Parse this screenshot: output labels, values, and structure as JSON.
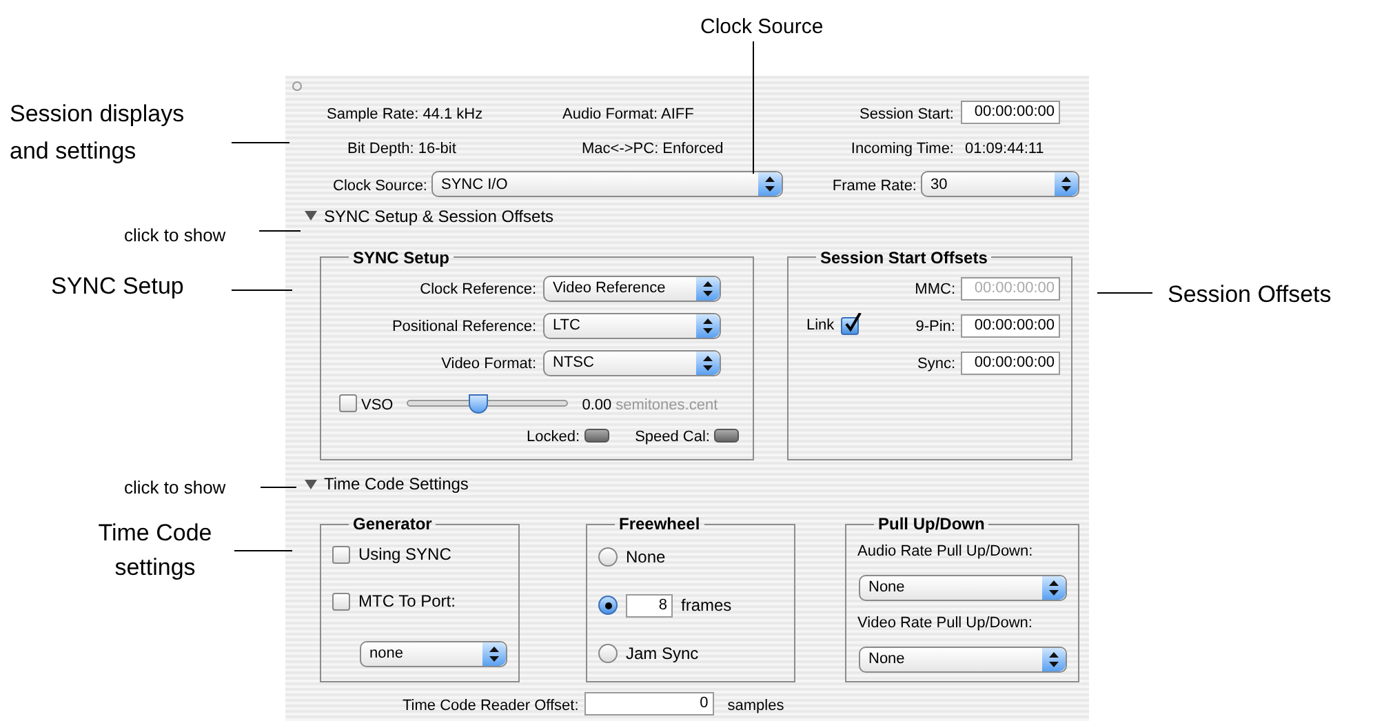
{
  "callouts": [
    {
      "text": "Clock Source"
    },
    {
      "text": "Session displays and settings"
    },
    {
      "text": "click to show"
    },
    {
      "text": "SYNC Setup"
    },
    {
      "text": "Session Offsets"
    },
    {
      "text": "click to show"
    },
    {
      "text": "Time Code settings"
    }
  ],
  "window": {
    "sample_rate": "Sample Rate: 44.1 kHz",
    "audio_format": "Audio Format: AIFF",
    "session_start": {
      "label": "Session Start:",
      "value": "00:00:00:00"
    },
    "bit_depth": "Bit Depth: 16-bit",
    "mac_pc": "Mac<->PC: Enforced",
    "incoming_time": {
      "label": "Incoming Time:",
      "value": "01:09:44:11"
    },
    "clock_source": {
      "label": "Clock Source:",
      "value": "SYNC I/O"
    },
    "frame_rate": {
      "label": "Frame Rate:",
      "value": "30"
    }
  },
  "sections": [
    {
      "title": "SYNC Setup & Session Offsets",
      "expanded": true
    },
    {
      "title": "Time Code Settings",
      "expanded": true
    }
  ],
  "sync_setup": {
    "title": "SYNC Setup",
    "popups": [
      {
        "label": "Clock Reference:",
        "value": "Video Reference"
      },
      {
        "label": "Positional Reference:",
        "value": "LTC"
      },
      {
        "label": "Video Format:",
        "value": "NTSC"
      }
    ],
    "vso": {
      "label": "VSO",
      "checked": false,
      "level": 0.43,
      "value": "0.00",
      "unit": "semitones.cent"
    },
    "indicators": [
      {
        "label": "Locked:"
      },
      {
        "label": "Speed Cal:"
      }
    ]
  },
  "session_start_offsets": {
    "title": "Session Start Offsets",
    "link": {
      "label": "Link",
      "checked": true
    },
    "fields": [
      {
        "label": "MMC:",
        "value": "00:00:00:00",
        "disabled": true
      },
      {
        "label": "9-Pin:",
        "value": "00:00:00:00",
        "disabled": false
      },
      {
        "label": "Sync:",
        "value": "00:00:00:00",
        "disabled": false
      }
    ]
  },
  "generator": {
    "title": "Generator",
    "checkboxes": [
      {
        "label": "Using SYNC",
        "checked": false
      },
      {
        "label": "MTC To Port:",
        "checked": false
      }
    ],
    "port": "none"
  },
  "freewheel": {
    "title": "Freewheel",
    "options": [
      {
        "kind": "plain",
        "label": "None",
        "selected": false
      },
      {
        "kind": "frames",
        "value": "8",
        "label": "frames",
        "selected": true
      },
      {
        "kind": "plain",
        "label": "Jam Sync",
        "selected": false
      }
    ]
  },
  "pull": {
    "title": "Pull Up/Down",
    "items": [
      {
        "label": "Audio Rate Pull Up/Down:",
        "value": "None"
      },
      {
        "label": "Video Rate Pull Up/Down:",
        "value": "None"
      }
    ]
  },
  "offset": {
    "label": "Time Code Reader Offset:",
    "value": "0",
    "unit": "samples"
  }
}
